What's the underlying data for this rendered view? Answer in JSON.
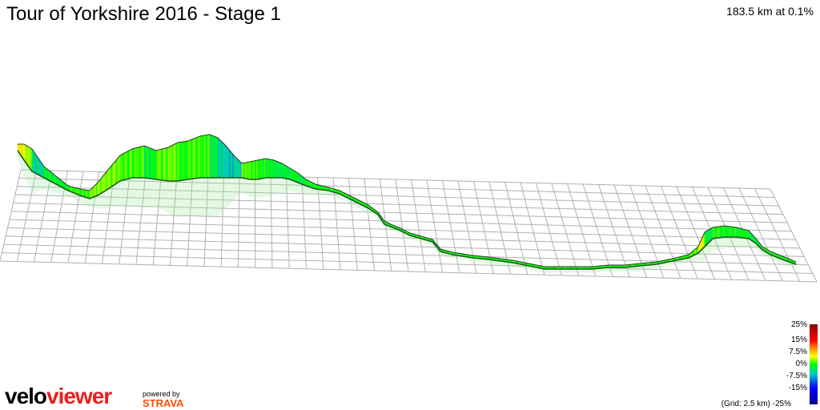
{
  "header": {
    "title": "Tour of Yorkshire 2016 - Stage 1",
    "summary": "183.5 km at 0.1%"
  },
  "legend": {
    "labels": [
      "25%",
      "15%",
      "7.5%",
      "0%",
      "-7.5%",
      "-15%",
      "-25%"
    ],
    "grid_note": "(Grid: 2.5 km)"
  },
  "branding": {
    "logo_part1": "velo",
    "logo_part2": "viewer",
    "powered_by": "powered by",
    "partner": "STRAVA"
  },
  "colors": {
    "gradient_high": "#8b0000",
    "gradient_mid": "#00ff00",
    "gradient_low": "#00008b",
    "grid": "#b0b0b0",
    "viewer_red": "#e8201a",
    "strava_orange": "#fc4c02"
  }
}
